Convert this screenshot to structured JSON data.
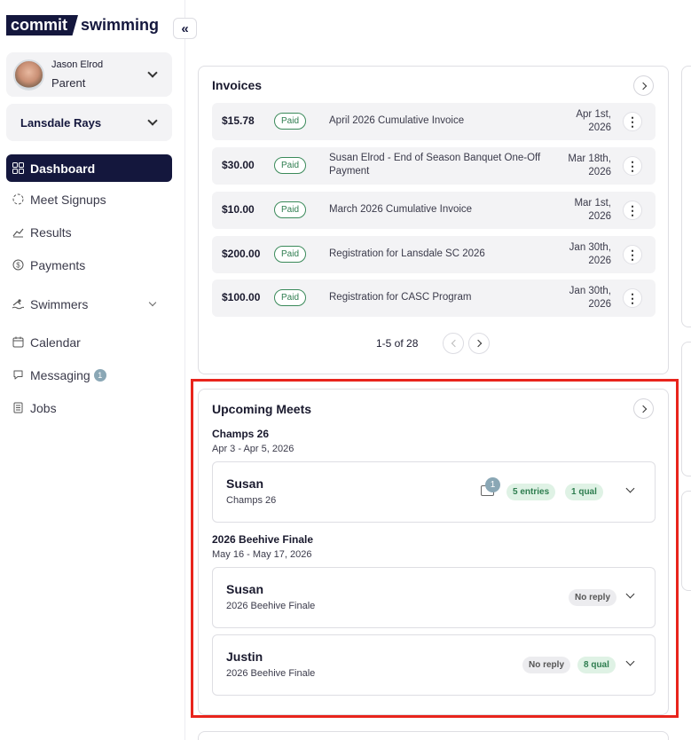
{
  "logo": {
    "part1": "commit",
    "part2": "swimming"
  },
  "collapse_label": "«",
  "user": {
    "name": "Jason Elrod",
    "role": "Parent"
  },
  "team": {
    "name": "Lansdale Rays"
  },
  "nav": [
    {
      "label": "Dashboard",
      "icon": "dashboard-icon"
    },
    {
      "label": "Meet Signups",
      "icon": "meet-signups-icon"
    },
    {
      "label": "Results",
      "icon": "results-icon"
    },
    {
      "label": "Payments",
      "icon": "payments-icon"
    },
    {
      "label": "Swimmers",
      "icon": "swimmers-icon"
    },
    {
      "label": "Calendar",
      "icon": "calendar-icon"
    },
    {
      "label": "Messaging",
      "icon": "messaging-icon",
      "badge": "1"
    },
    {
      "label": "Jobs",
      "icon": "jobs-icon"
    }
  ],
  "invoices": {
    "title": "Invoices",
    "rows": [
      {
        "amount": "$15.78",
        "status": "Paid",
        "desc": "April 2026 Cumulative Invoice",
        "date1": "Apr 1st,",
        "date2": "2026"
      },
      {
        "amount": "$30.00",
        "status": "Paid",
        "desc": "Susan Elrod - End of Season Banquet One-Off Payment",
        "date1": "Mar 18th,",
        "date2": "2026"
      },
      {
        "amount": "$10.00",
        "status": "Paid",
        "desc": "March 2026 Cumulative Invoice",
        "date1": "Mar 1st,",
        "date2": "2026"
      },
      {
        "amount": "$200.00",
        "status": "Paid",
        "desc": "Registration for Lansdale SC 2026",
        "date1": "Jan 30th,",
        "date2": "2026"
      },
      {
        "amount": "$100.00",
        "status": "Paid",
        "desc": "Registration for CASC Program",
        "date1": "Jan 30th,",
        "date2": "2026"
      }
    ],
    "pagination": "1-5 of 28"
  },
  "upcoming": {
    "title": "Upcoming Meets",
    "meets": [
      {
        "name": "Champs 26",
        "dates": "Apr 3 - Apr 5, 2026",
        "entries": [
          {
            "swimmer": "Susan",
            "meet": "Champs 26",
            "msg_count": "1",
            "pill1": "5 entries",
            "pill2": "1 qual"
          }
        ]
      },
      {
        "name": "2026 Beehive Finale",
        "dates": "May 16 - May 17, 2026",
        "entries": [
          {
            "swimmer": "Susan",
            "meet": "2026 Beehive Finale",
            "pill1": "No reply"
          },
          {
            "swimmer": "Justin",
            "meet": "2026 Beehive Finale",
            "pill1": "No reply",
            "pill2": "8 qual"
          }
        ]
      }
    ]
  },
  "colors": {
    "brand": "#14173d",
    "paid": "#2e7d4f",
    "highlight": "#e8241c",
    "badge": "#8aa7b5"
  }
}
